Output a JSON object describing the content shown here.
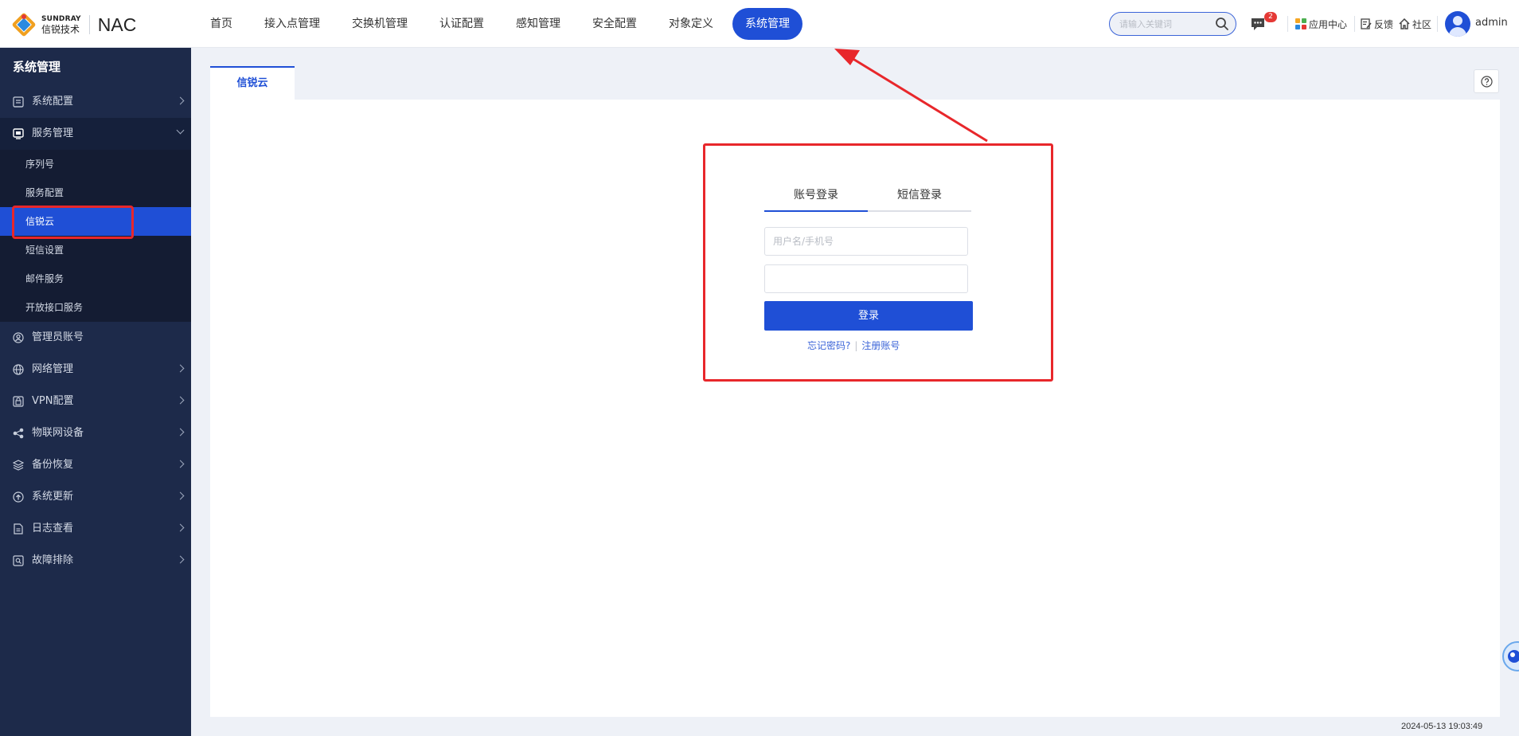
{
  "logo": {
    "brand_en": "SUNDRAY",
    "brand_cn": "信锐技术",
    "product": "NAC"
  },
  "nav": {
    "items": [
      {
        "label": "首页"
      },
      {
        "label": "接入点管理"
      },
      {
        "label": "交换机管理"
      },
      {
        "label": "认证配置"
      },
      {
        "label": "感知管理"
      },
      {
        "label": "安全配置"
      },
      {
        "label": "对象定义"
      },
      {
        "label": "系统管理",
        "active": true
      }
    ]
  },
  "topbar": {
    "search_placeholder": "请输入关键词",
    "message_count": "2",
    "app_center": "应用中心",
    "feedback": "反馈",
    "community": "社区",
    "username": "admin"
  },
  "sidebar": {
    "title": "系统管理",
    "items": [
      {
        "label": "系统配置",
        "icon": "settings-list-icon"
      },
      {
        "label": "服务管理",
        "icon": "monitor-icon",
        "expanded": true,
        "children": [
          {
            "label": "序列号"
          },
          {
            "label": "服务配置"
          },
          {
            "label": "信锐云",
            "active": true
          },
          {
            "label": "短信设置"
          },
          {
            "label": "邮件服务"
          },
          {
            "label": "开放接口服务"
          }
        ]
      },
      {
        "label": "管理员账号",
        "icon": "user-circle-icon"
      },
      {
        "label": "网络管理",
        "icon": "network-icon"
      },
      {
        "label": "VPN配置",
        "icon": "vpn-lock-icon"
      },
      {
        "label": "物联网设备",
        "icon": "iot-nodes-icon"
      },
      {
        "label": "备份恢复",
        "icon": "layers-icon"
      },
      {
        "label": "系统更新",
        "icon": "upload-circle-icon"
      },
      {
        "label": "日志查看",
        "icon": "document-icon"
      },
      {
        "label": "故障排除",
        "icon": "diagnose-icon"
      }
    ]
  },
  "main": {
    "tab_label": "信锐云",
    "login": {
      "tab_account": "账号登录",
      "tab_sms": "短信登录",
      "username_placeholder": "用户名/手机号",
      "password_placeholder": "",
      "submit": "登录",
      "forgot": "忘记密码?",
      "separator": "|",
      "register": "注册账号"
    }
  },
  "footer": {
    "timestamp": "2024-05-13 19:03:49"
  },
  "colors": {
    "accent": "#1f4fd6",
    "sidebar": "#1d2a4a",
    "annotation": "#e8272b",
    "badge": "#e53935"
  }
}
